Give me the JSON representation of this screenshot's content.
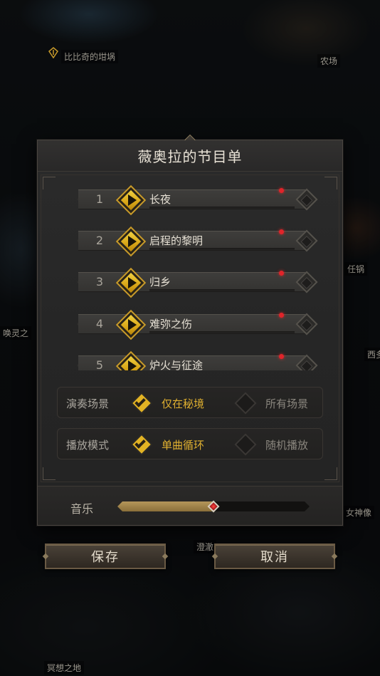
{
  "map": {
    "labels": [
      "比比奇的坩埚",
      "农场",
      "唤灵之",
      "任锅",
      "西多",
      "女神像",
      "澄澈",
      "冥想之地"
    ]
  },
  "dialog": {
    "title": "薇奥拉的节目单"
  },
  "songs": [
    {
      "number": "1",
      "name": "长夜"
    },
    {
      "number": "2",
      "name": "启程的黎明"
    },
    {
      "number": "3",
      "name": "归乡"
    },
    {
      "number": "4",
      "name": "难弥之伤"
    },
    {
      "number": "5",
      "name": "炉火与征途"
    }
  ],
  "options": {
    "scene": {
      "label": "演奏场景",
      "choice_a": "仅在秘境",
      "choice_b": "所有场景",
      "selected": "choice_a"
    },
    "mode": {
      "label": "播放模式",
      "choice_a": "单曲循环",
      "choice_b": "随机播放",
      "selected": "choice_a"
    }
  },
  "music": {
    "label": "音乐",
    "volume_fraction": 0.5
  },
  "buttons": {
    "save": "保存",
    "cancel": "取消"
  },
  "colors": {
    "accent_gold": "#d9a618",
    "active_text": "#e0b030",
    "notification_red": "#e0242a"
  },
  "icons": {
    "play": "play-icon",
    "check": "check-icon",
    "marker": "map-marker-icon"
  }
}
